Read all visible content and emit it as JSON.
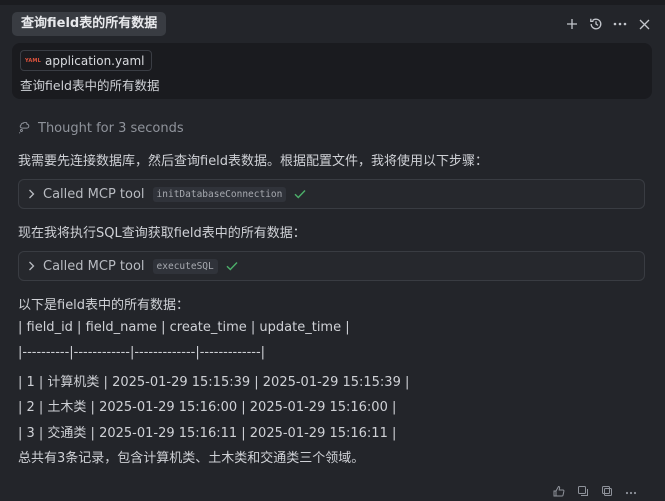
{
  "header": {
    "title": "查询field表的所有数据"
  },
  "query": {
    "file_badge": "YAML",
    "file_name": "application.yaml",
    "text": "查询field表中的所有数据"
  },
  "thought": {
    "text": "Thought for 3 seconds"
  },
  "messages": {
    "intro": "我需要先连接数据库，然后查询field表数据。根据配置文件，我将使用以下步骤：",
    "step2": "现在我将执行SQL查询获取field表中的所有数据：",
    "result_heading": "以下是field表中的所有数据：",
    "table_lines": [
      "| field_id | field_name | create_time | update_time |",
      "|----------|------------|-------------|-------------|",
      "| 1 | 计算机类 | 2025-01-29 15:15:39 | 2025-01-29 15:15:39 |",
      "| 2 | 土木类 | 2025-01-29 15:16:00 | 2025-01-29 15:16:00 |",
      "| 3 | 交通类 | 2025-01-29 15:16:11 | 2025-01-29 15:16:11 |"
    ],
    "summary": "总共有3条记录，包含计算机类、土木类和交通类三个领域。"
  },
  "tool_calls": [
    {
      "label": "Called MCP tool",
      "tool": "initDatabaseConnection",
      "status_icon": "check-icon"
    },
    {
      "label": "Called MCP tool",
      "tool": "executeSQL",
      "status_icon": "check-icon"
    }
  ],
  "colors": {
    "background": "#23252a",
    "panel": "#1a1b1f",
    "success": "#4caf6a",
    "yaml_badge": "#e0533d"
  },
  "icons": {
    "header": [
      "plus-icon",
      "history-icon",
      "more-icon",
      "close-icon"
    ],
    "footer": [
      "thumbs-up-icon",
      "copy-icon",
      "duplicate-icon",
      "more-icon"
    ]
  }
}
